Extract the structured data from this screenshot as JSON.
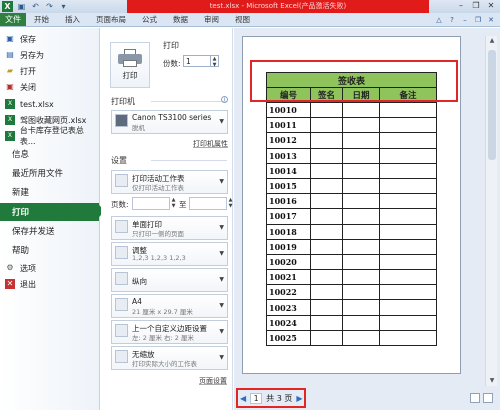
{
  "window": {
    "title": "test.xlsx - Microsoft Excel(产品激活失败)"
  },
  "ribbon": {
    "file_tab": "文件",
    "tabs": [
      "开始",
      "插入",
      "页面布局",
      "公式",
      "数据",
      "审阅",
      "视图"
    ]
  },
  "nav": {
    "save": "保存",
    "save_as": "另存为",
    "open": "打开",
    "close": "关闭",
    "recent_files": [
      "test.xlsx",
      "驾图收藏网页.xlsx",
      "台卡库存登记表总表..."
    ],
    "info": "信息",
    "recent": "最近所用文件",
    "new": "新建",
    "print": "打印",
    "save_send": "保存并发送",
    "help": "帮助",
    "options": "选项",
    "exit": "退出"
  },
  "print_panel": {
    "heading": "打印",
    "button_label": "打印",
    "copies_label": "份数:",
    "copies_value": "1",
    "printer_section": "打印机",
    "printer_name": "Canon TS3100 series",
    "printer_status": "脱机",
    "printer_properties": "打印机属性",
    "settings_section": "设置",
    "scope_main": "打印活动工作表",
    "scope_sub": "仅打印活动工作表",
    "pages_label": "页数:",
    "to_label": "至",
    "sides_main": "单面打印",
    "sides_sub": "只打印一侧的页面",
    "collate_main": "调整",
    "collate_sub": "1,2,3    1,2,3    1,2,3",
    "orientation_main": "纵向",
    "paper_main": "A4",
    "paper_sub": "21 厘米 x 29.7 厘米",
    "margins_main": "上一个自定义边距设置",
    "margins_sub": "左: 2 厘米    右: 2 厘米",
    "scaling_main": "无缩放",
    "scaling_sub": "打印实际大小的工作表",
    "page_setup": "页面设置"
  },
  "preview": {
    "sheet_title": "签收表",
    "headers": [
      "编号",
      "签名",
      "日期",
      "备注"
    ],
    "rows": [
      "10010",
      "10011",
      "10012",
      "10013",
      "10014",
      "10015",
      "10016",
      "10017",
      "10018",
      "10019",
      "10020",
      "10021",
      "10022",
      "10023",
      "10024",
      "10025"
    ],
    "page_current": "1",
    "page_total": "共 3 页"
  },
  "colors": {
    "file_tab": "#2f7f3f",
    "active_nav": "#1f7a3c",
    "header_fill": "#8fc35c",
    "highlight_box": "#e12626"
  }
}
